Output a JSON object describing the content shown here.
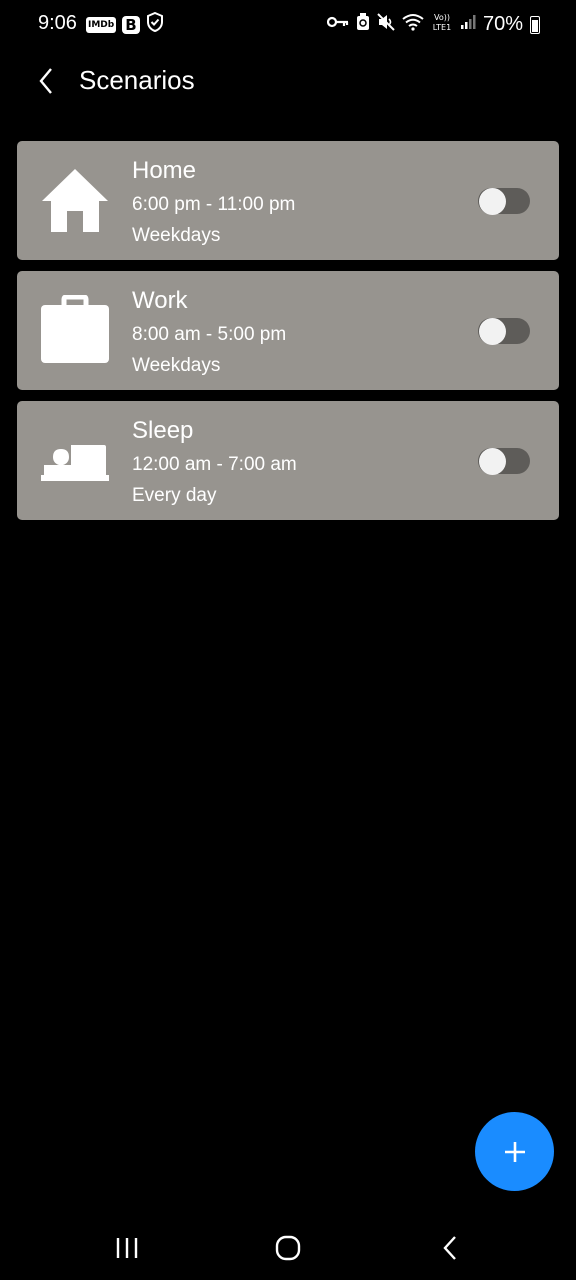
{
  "status_bar": {
    "time": "9:06",
    "left_icons": [
      "IMDb",
      "B"
    ],
    "battery": "70%"
  },
  "header": {
    "title": "Scenarios"
  },
  "scenarios": [
    {
      "name": "Home",
      "time": "6:00 pm - 11:00 pm",
      "days": "Weekdays",
      "icon": "house-icon",
      "enabled": false
    },
    {
      "name": "Work",
      "time": "8:00 am - 5:00 pm",
      "days": "Weekdays",
      "icon": "briefcase-icon",
      "enabled": false
    },
    {
      "name": "Sleep",
      "time": "12:00 am - 7:00 am",
      "days": "Every day",
      "icon": "bed-icon",
      "enabled": false
    }
  ],
  "colors": {
    "background": "#000000",
    "card": "#97948f",
    "toggle_off_track": "#5e5c59",
    "fab": "#1a8cff"
  }
}
